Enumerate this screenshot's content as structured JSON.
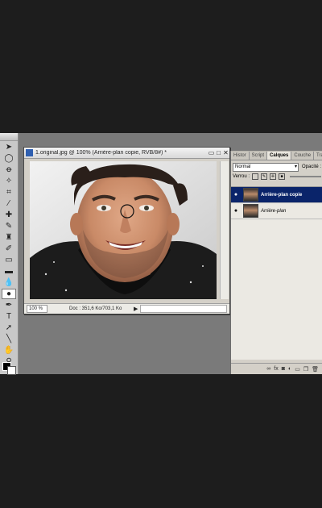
{
  "document": {
    "title": "1.original.jpg @ 100% (Arrière-plan copie, RVB/8#) *",
    "zoom": "100 %",
    "doc_info": "Doc : 351,6 Ko/703,1 Ko"
  },
  "tools": [
    {
      "icon": "move-icon",
      "glyph": "➤"
    },
    {
      "icon": "marquee-icon",
      "glyph": "◯"
    },
    {
      "icon": "lasso-icon",
      "glyph": "ꝋ"
    },
    {
      "icon": "magic-wand-icon",
      "glyph": "✧"
    },
    {
      "icon": "crop-icon",
      "glyph": "⌗"
    },
    {
      "icon": "eyedropper-icon",
      "glyph": "⁄"
    },
    {
      "icon": "healing-brush-icon",
      "glyph": "✚"
    },
    {
      "icon": "brush-icon",
      "glyph": "✎"
    },
    {
      "icon": "clone-stamp-icon",
      "glyph": "♜"
    },
    {
      "icon": "history-brush-icon",
      "glyph": "✐"
    },
    {
      "icon": "eraser-icon",
      "glyph": "▭"
    },
    {
      "icon": "gradient-icon",
      "glyph": "▬"
    },
    {
      "icon": "blur-icon",
      "glyph": "💧"
    },
    {
      "icon": "dodge-icon",
      "glyph": "●"
    },
    {
      "icon": "pen-icon",
      "glyph": "✒"
    },
    {
      "icon": "type-icon",
      "glyph": "T"
    },
    {
      "icon": "path-selection-icon",
      "glyph": "➚"
    },
    {
      "icon": "line-icon",
      "glyph": "╲"
    },
    {
      "icon": "hand-icon",
      "glyph": "✋"
    },
    {
      "icon": "zoom-icon",
      "glyph": "⚲"
    }
  ],
  "panel": {
    "tabs": [
      "Histor",
      "Script",
      "Calques",
      "Couche",
      "Tra"
    ],
    "active_tab": "Calques",
    "blend_mode": "Normal",
    "opacity_label": "Opacité :",
    "lock_label": "Verrou :",
    "layers": [
      {
        "name": "Arrière-plan copie",
        "active": true
      },
      {
        "name": "Arrière-plan",
        "active": false
      }
    ],
    "footer_icons": [
      "link-icon",
      "fx-icon",
      "mask-icon",
      "adjustment-icon",
      "folder-icon",
      "new-layer-icon",
      "trash-icon"
    ]
  },
  "colors": {
    "background": "#1d1d1d",
    "workspace": "#7a7a7a",
    "active_layer": "#0a246a",
    "foreground_swatch": "#000000",
    "background_swatch": "#ffffff"
  }
}
